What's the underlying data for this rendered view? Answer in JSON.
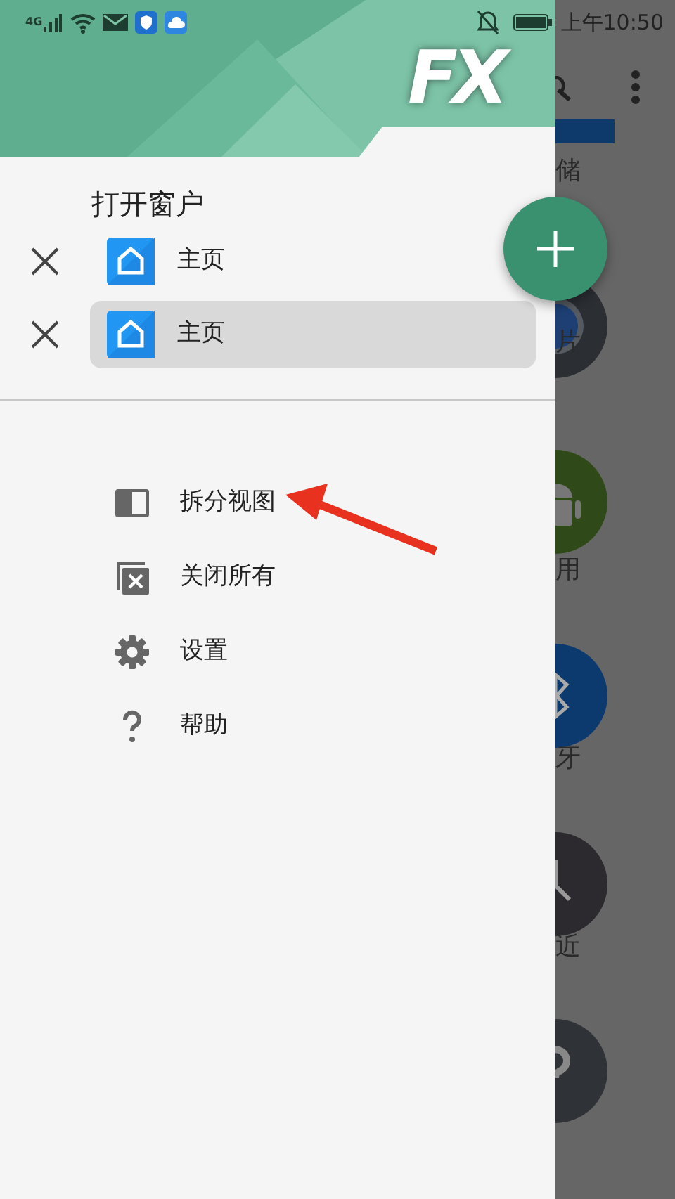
{
  "status_bar": {
    "network": "4G",
    "time": "上午10:50"
  },
  "drawer": {
    "logo": "FX",
    "section_title": "打开窗户",
    "windows": [
      {
        "label": "主页",
        "selected": false
      },
      {
        "label": "主页",
        "selected": true
      }
    ],
    "menu": [
      {
        "kind": "split",
        "label": "拆分视图"
      },
      {
        "kind": "close_all",
        "label": "关闭所有"
      },
      {
        "kind": "settings",
        "label": "设置"
      },
      {
        "kind": "help",
        "label": "帮助"
      }
    ]
  },
  "background_app": {
    "items": [
      {
        "kind": "storage",
        "label": "储"
      },
      {
        "kind": "pictures",
        "label": "片"
      },
      {
        "kind": "apps",
        "label": "用"
      },
      {
        "kind": "bluetooth",
        "label": "牙"
      },
      {
        "kind": "recent",
        "label": "近"
      },
      {
        "kind": "help"
      }
    ]
  }
}
